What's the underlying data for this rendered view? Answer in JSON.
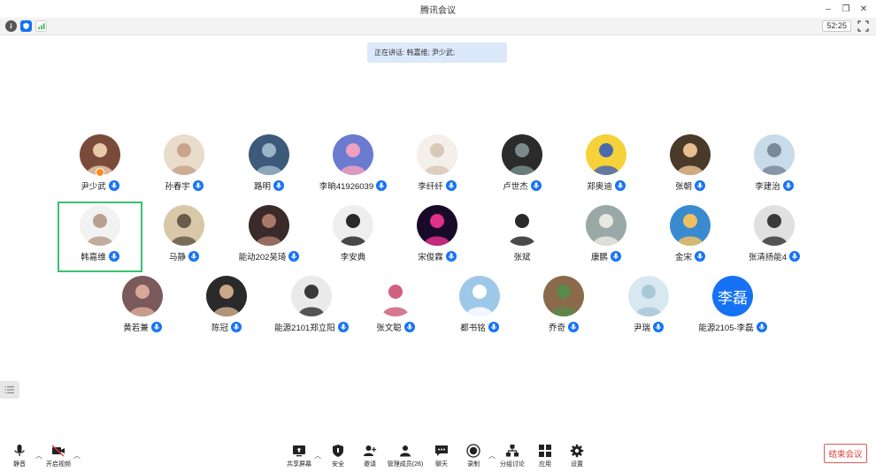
{
  "window": {
    "title": "腾讯会议",
    "minimize": "–",
    "restore": "❐",
    "close": "✕"
  },
  "info_bar": {
    "timer": "52:25"
  },
  "speaking": "正在讲话: 韩嘉维; 尹少武;",
  "participants": [
    {
      "name": "尹少武",
      "mic": true,
      "host": true
    },
    {
      "name": "孙春宇",
      "mic": true
    },
    {
      "name": "路明",
      "mic": true
    },
    {
      "name": "李晌41926039",
      "mic": true
    },
    {
      "name": "李纤纤",
      "mic": true
    },
    {
      "name": "卢世杰",
      "mic": true
    },
    {
      "name": "郑奥迪",
      "mic": true
    },
    {
      "name": "张朝",
      "mic": true
    },
    {
      "name": "李建治",
      "mic": true
    },
    {
      "name": "韩嘉维",
      "mic": true,
      "selected": true
    },
    {
      "name": "马静",
      "mic": true
    },
    {
      "name": "能动202吴琦",
      "mic": true
    },
    {
      "name": "李安典",
      "mic": false
    },
    {
      "name": "宋俊霖",
      "mic": true
    },
    {
      "name": "张斌",
      "mic": false
    },
    {
      "name": "康鹏",
      "mic": true
    },
    {
      "name": "金宋",
      "mic": true
    },
    {
      "name": "张清扬能4",
      "mic": true
    },
    {
      "name": "黄若兼",
      "mic": true
    },
    {
      "name": "陈冠",
      "mic": true
    },
    {
      "name": "能源2101郑立阳",
      "mic": true
    },
    {
      "name": "张文聪",
      "mic": true
    },
    {
      "name": "都书铭",
      "mic": true
    },
    {
      "name": "乔奇",
      "mic": true
    },
    {
      "name": "尹瑞",
      "mic": true
    },
    {
      "name": "能源2105-李磊",
      "mic": true,
      "letter": "李磊"
    }
  ],
  "toolbar": {
    "mute": "静音",
    "video": "开启视频",
    "share": "共享屏幕",
    "security": "安全",
    "invite": "邀请",
    "members": "管理成员(26)",
    "chat": "聊天",
    "record": "录制",
    "breakout": "分组讨论",
    "apps": "应用",
    "settings": "设置",
    "end": "结束会议"
  },
  "colors": {
    "accent": "#1572f5",
    "end": "#e03a3a",
    "selected": "#37c36b",
    "banner": "#dce9fb"
  }
}
